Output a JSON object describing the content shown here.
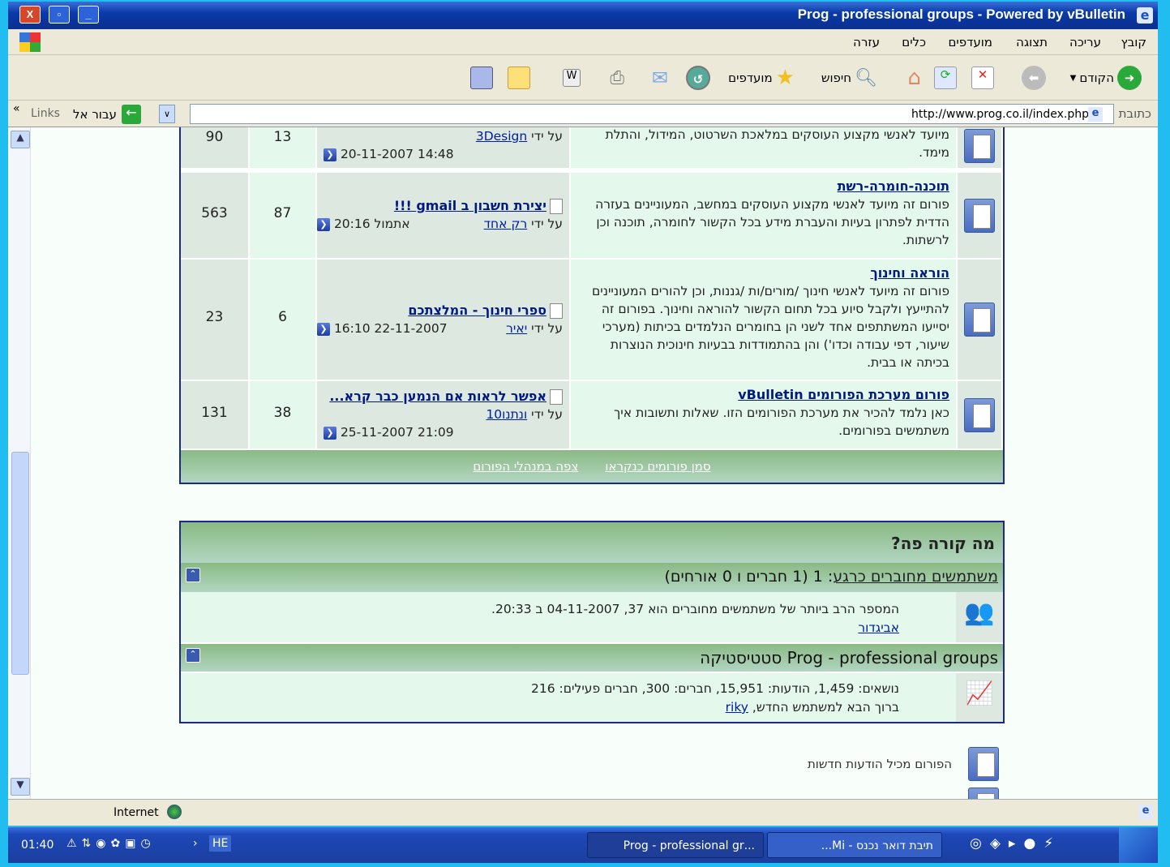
{
  "window": {
    "title": "Prog - professional groups - Powered by vBulletin"
  },
  "menu": [
    "קובץ",
    "עריכה",
    "תצוגה",
    "מועדפים",
    "כלים",
    "עזרה"
  ],
  "toolbar": {
    "back": "הקודם",
    "search": "חיפוש",
    "favorites": "מועדפים"
  },
  "address": {
    "label": "כתובת",
    "url": "http://www.prog.co.il/index.php",
    "go": "עבור אל",
    "links": "Links"
  },
  "forums": [
    {
      "title": "",
      "desc": "מיועד לאנשי מקצוע העוסקים במלאכת השרטוט, המידול, והתלת מימד.",
      "thread": "",
      "by_label": "על ידי",
      "user": "3Design",
      "date": "20-11-2007",
      "time": "14:48",
      "threads": "13",
      "posts": "90"
    },
    {
      "title": "תוכנה-חומרה-רשת",
      "desc": "פורום זה מיועד לאנשי מקצוע העוסקים במחשב, המעוניינים בעזרה הדדית לפתרון בעיות והעברת מידע בכל הקשור לחומרה, תוכנה וכן לרשתות.",
      "thread": "יצירת חשבון ב gmail !!!",
      "by_label": "על ידי",
      "user": "רק אחד",
      "date": "אתמול",
      "time": "20:16",
      "threads": "87",
      "posts": "563"
    },
    {
      "title": "הוראה וחינוך",
      "desc": "פורום זה מיועד לאנשי חינוך /מורים/ות /גננות, וכן להורים המעוניינים להתייעץ ולקבל סיוע בכל תחום הקשור להוראה וחינוך. בפורום זה יסייעו המשתתפים אחד לשני הן בחומרים הנלמדים בכיתות (מערכי שיעור, דפי עבודה וכדו') והן בהתמודדות בבעיות חינוכית הנוצרות בכיתה או בבית.",
      "thread": "ספרי חינוך - המלצתכם",
      "by_label": "על ידי",
      "user": "יאיר",
      "date": "22-11-2007",
      "time": "16:10",
      "threads": "6",
      "posts": "23"
    },
    {
      "title": "פורום מערכת הפורומים vBulletin",
      "desc": "כאן נלמד להכיר את מערכת הפורומים הזו. שאלות ותשובות איך משתמשים בפורומים.",
      "thread": "אפשר לראות אם הנמען כבר קרא...",
      "by_label": "על ידי",
      "user": "ונתנו10",
      "date": "25-11-2007",
      "time": "21:09",
      "threads": "38",
      "posts": "131"
    }
  ],
  "forum_footer": {
    "mark_read": "סמן פורומים כנקראו",
    "view_leaders": "צפה במנהלי הפורום"
  },
  "whats_going_on": {
    "title": "מה קורה פה?",
    "online_link": "משתמשים מחוברים כרגע",
    "online_count": ": 1 (1 חברים ו 0 אורחים)",
    "record": "המספר הרב ביותר של משתמשים מחוברים הוא 37, 04-11-2007 ב 20:33.",
    "online_user": "אביגדור",
    "stats_title": "Prog - professional groups סטטיסטיקה",
    "stats": "נושאים: 1,459, הודעות: 15,951, חברים: 300, חברים פעילים: 216",
    "welcome": "ברוך הבא למשתמש החדש,",
    "newest_user": "riky"
  },
  "legend": {
    "new_posts": "הפורום מכיל הודעות חדשות"
  },
  "status": {
    "zone": "Internet"
  },
  "taskbar": {
    "tasks": [
      "...Prog - professional gr",
      "תיבת דואר נכנס - Mi..."
    ],
    "lang": "HE",
    "clock": "01:40"
  }
}
